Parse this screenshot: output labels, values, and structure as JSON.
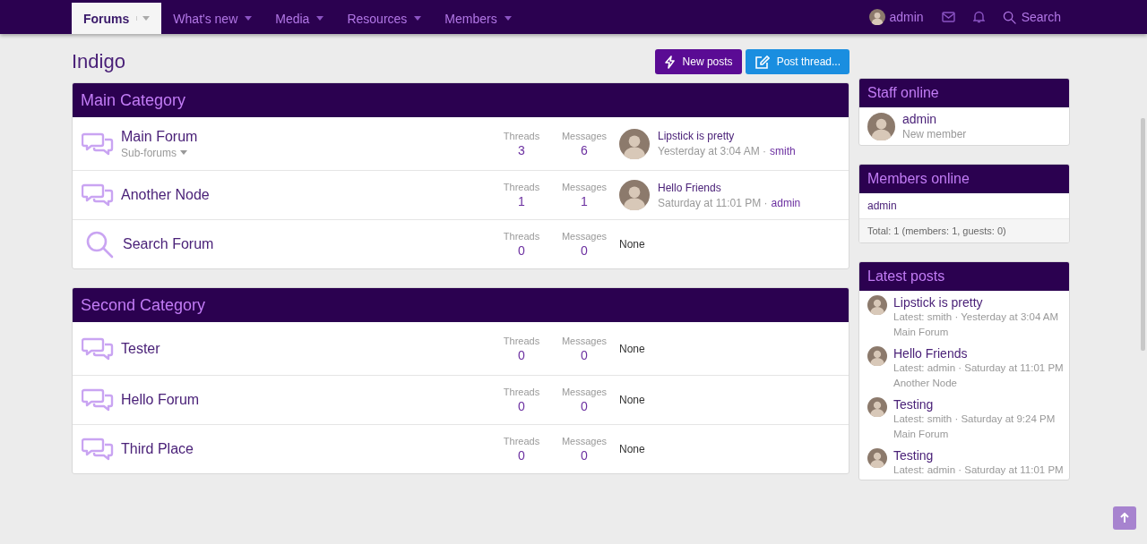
{
  "nav": {
    "items": [
      {
        "label": "Forums",
        "selected": true
      },
      {
        "label": "What's new",
        "selected": false
      },
      {
        "label": "Media",
        "selected": false
      },
      {
        "label": "Resources",
        "selected": false
      },
      {
        "label": "Members",
        "selected": false
      }
    ],
    "user": "admin",
    "search": "Search"
  },
  "page_title": "Indigo",
  "actions": [
    {
      "kind": "new_posts",
      "label": "New posts"
    },
    {
      "kind": "post_thread",
      "label": "Post thread..."
    }
  ],
  "categories": [
    {
      "title": "Main Category",
      "nodes": [
        {
          "kind": "forum",
          "title": "Main Forum",
          "subforums": "Sub-forums",
          "stats": [
            {
              "label": "Threads",
              "value": "3"
            },
            {
              "label": "Messages",
              "value": "6"
            }
          ],
          "latest": {
            "title": "Lipstick is pretty",
            "time": "Yesterday at 3:04 AM",
            "sep": "·",
            "user": "smith"
          }
        },
        {
          "kind": "forum",
          "title": "Another Node",
          "stats": [
            {
              "label": "Threads",
              "value": "1"
            },
            {
              "label": "Messages",
              "value": "1"
            }
          ],
          "latest": {
            "title": "Hello Friends",
            "time": "Saturday at 11:01 PM",
            "sep": "·",
            "user": "admin"
          }
        },
        {
          "kind": "search",
          "title": "Search Forum",
          "stats": [
            {
              "label": "Threads",
              "value": "0"
            },
            {
              "label": "Messages",
              "value": "0"
            }
          ],
          "none": "None"
        }
      ]
    },
    {
      "title": "Second Category",
      "nodes": [
        {
          "kind": "forum",
          "title": "Tester",
          "stats": [
            {
              "label": "Threads",
              "value": "0"
            },
            {
              "label": "Messages",
              "value": "0"
            }
          ],
          "none": "None"
        },
        {
          "kind": "forum",
          "title": "Hello Forum",
          "stats": [
            {
              "label": "Threads",
              "value": "0"
            },
            {
              "label": "Messages",
              "value": "0"
            }
          ],
          "none": "None"
        },
        {
          "kind": "forum",
          "title": "Third Place",
          "stats": [
            {
              "label": "Threads",
              "value": "0"
            },
            {
              "label": "Messages",
              "value": "0"
            }
          ],
          "none": "None"
        }
      ]
    }
  ],
  "sidebar": {
    "staff_online": {
      "title": "Staff online",
      "members": [
        {
          "name": "admin",
          "role": "New member"
        }
      ]
    },
    "members_online": {
      "title": "Members online",
      "members": [
        "admin"
      ],
      "total": "Total: 1 (members: 1, guests: 0)"
    },
    "latest_posts": {
      "title": "Latest posts",
      "posts": [
        {
          "title": "Lipstick is pretty",
          "meta": "Latest: smith · Yesterday at 3:04 AM",
          "forum": "Main Forum"
        },
        {
          "title": "Hello Friends",
          "meta": "Latest: admin · Saturday at 11:01 PM",
          "forum": "Another Node"
        },
        {
          "title": "Testing",
          "meta": "Latest: smith · Saturday at 9:24 PM",
          "forum": "Main Forum"
        },
        {
          "title": "Testing",
          "meta": "Latest: admin · Saturday at 11:01 PM"
        }
      ]
    }
  }
}
